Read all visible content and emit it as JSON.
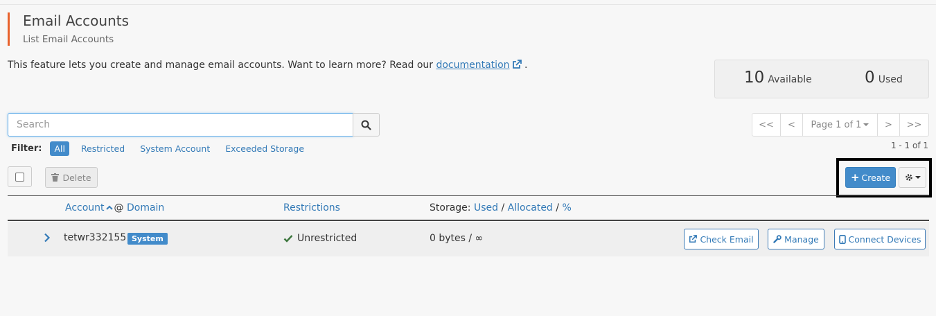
{
  "header": {
    "title": "Email Accounts",
    "subtitle": "List Email Accounts"
  },
  "intro": {
    "text": "This feature lets you create and manage email accounts. Want to learn more? Read our ",
    "link_label": "documentation",
    "suffix": "."
  },
  "stats": {
    "available_count": "10",
    "available_label": "Available",
    "used_count": "0",
    "used_label": "Used"
  },
  "search": {
    "placeholder": "Search",
    "value": ""
  },
  "pager": {
    "first": "<<",
    "prev": "<",
    "page_label": "Page 1 of 1",
    "next": ">",
    "last": ">>",
    "range": "1 - 1 of 1"
  },
  "filter": {
    "label": "Filter:",
    "options": [
      "All",
      "Restricted",
      "System Account",
      "Exceeded Storage"
    ],
    "selected": "All"
  },
  "toolbar": {
    "delete_label": "Delete",
    "create_label": "Create"
  },
  "table": {
    "headers": {
      "account": "Account",
      "at": "@",
      "domain": "Domain",
      "restrictions": "Restrictions",
      "storage_prefix": "Storage:",
      "used": "Used",
      "sep1": "/",
      "allocated": "Allocated",
      "sep2": "/",
      "percent": "%"
    },
    "rows": [
      {
        "account": "tetwr332155",
        "badge": "System",
        "restriction": "Unrestricted",
        "storage": "0 bytes / ∞",
        "actions": [
          "Check Email",
          "Manage",
          "Connect Devices"
        ]
      }
    ]
  },
  "colors": {
    "accent": "#428bca",
    "link": "#337ab7",
    "header_bar": "#e8622c",
    "success": "#3c763d"
  }
}
